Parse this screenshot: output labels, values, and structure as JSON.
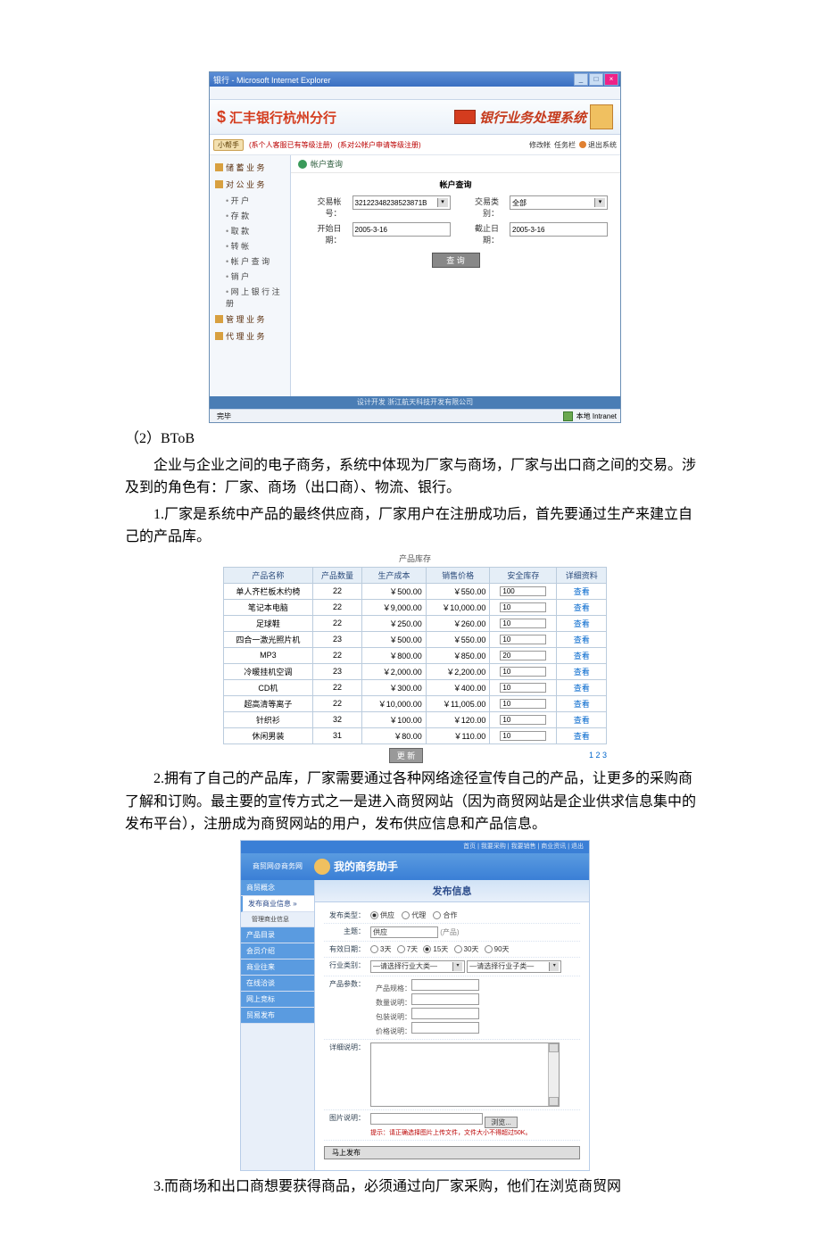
{
  "bank": {
    "window_title": "银行 - Microsoft Internet Explorer",
    "brand_symbol": "$",
    "brand_text": "汇丰银行杭州分行",
    "system_text": "银行业务处理系统",
    "notice_handbook": "小帮手",
    "notice1": "(系个人客服已有等级注册)",
    "notice2": "(系对公帐户申请等级注册)",
    "nr_change": "修改帐",
    "nr_task": "任务栏",
    "nr_exit": "退出系统",
    "sub_title": "帐户查询",
    "form_title": "帐户查询",
    "form": {
      "acct_label": "交易帐号：",
      "acct_value": "32122348238523871B",
      "type_label": "交易类别：",
      "type_value": "全部",
      "start_label": "开始日期：",
      "start_value": "2005-3-16",
      "end_label": "截止日期：",
      "end_value": "2005-3-16",
      "search_btn": "查 询"
    },
    "sidebar": {
      "deposit": "储 蓄 业 务",
      "personal": "对 公 业 务",
      "items": [
        "开 户",
        "存 款",
        "取 款",
        "转 帐",
        "帐 户 查 询",
        "销 户",
        "网 上 银 行 注 册"
      ],
      "mgmt": "管 理 业 务",
      "fin": "代 理 业 务"
    },
    "footer": "设计开发 浙江航天科技开发有限公司",
    "status_done": "完毕",
    "status_net": "本地 Intranet"
  },
  "text": {
    "line1_label": "（2）BToB",
    "para1": "企业与企业之间的电子商务，系统中体现为厂家与商场，厂家与出口商之间的交易。涉及到的角色有：厂家、商场（出口商）、物流、银行。",
    "para2": "1.厂家是系统中产品的最终供应商，厂家用户在注册成功后，首先要通过生产来建立自己的产品库。",
    "para3": "2.拥有了自己的产品库，厂家需要通过各种网络途径宣传自己的产品，让更多的采购商了解和订购。最主要的宣传方式之一是进入商贸网站（因为商贸网站是企业供求信息集中的发布平台），注册成为商贸网站的用户，发布供应信息和产品信息。",
    "para4": "3.而商场和出口商想要获得商品，必须通过向厂家采购，他们在浏览商贸网"
  },
  "inv": {
    "title": "产品库存",
    "headers": [
      "产品名称",
      "产品数量",
      "生产成本",
      "销售价格",
      "安全库存",
      "详细资料"
    ],
    "look": "查看",
    "update_btn": "更 新",
    "pager": "1 2 3",
    "rows": [
      {
        "name": "单人齐栏板木约椅",
        "qty": 22,
        "cost": "￥500.00",
        "price": "￥550.00",
        "safe": "100"
      },
      {
        "name": "笔记本电脑",
        "qty": 22,
        "cost": "￥9,000.00",
        "price": "￥10,000.00",
        "safe": "10"
      },
      {
        "name": "足球鞋",
        "qty": 22,
        "cost": "￥250.00",
        "price": "￥260.00",
        "safe": "10"
      },
      {
        "name": "四合一激光照片机",
        "qty": 23,
        "cost": "￥500.00",
        "price": "￥550.00",
        "safe": "10"
      },
      {
        "name": "MP3",
        "qty": 22,
        "cost": "￥800.00",
        "price": "￥850.00",
        "safe": "20"
      },
      {
        "name": "冷暖挂机空调",
        "qty": 23,
        "cost": "￥2,000.00",
        "price": "￥2,200.00",
        "safe": "10"
      },
      {
        "name": "CD机",
        "qty": 22,
        "cost": "￥300.00",
        "price": "￥400.00",
        "safe": "10"
      },
      {
        "name": "超高清等离子",
        "qty": 22,
        "cost": "￥10,000.00",
        "price": "￥11,005.00",
        "safe": "10"
      },
      {
        "name": "针织衫",
        "qty": 32,
        "cost": "￥100.00",
        "price": "￥120.00",
        "safe": "10"
      },
      {
        "name": "休闲男装",
        "qty": 31,
        "cost": "￥80.00",
        "price": "￥110.00",
        "safe": "10"
      }
    ]
  },
  "pub": {
    "topbar": "首页 | 我要采购 | 我要销售 | 商业资讯 | 退出",
    "logo": "商贸网@商务网",
    "title": "我的商务助手",
    "side": {
      "head": "商贸概念",
      "active": "发布商业信息 »",
      "sub": "管理商业信息",
      "items": [
        "产品目录",
        "会员介绍",
        "商业往来",
        "在线洽谈",
        "网上竞标",
        "贸易发布"
      ]
    },
    "main_title": "发布信息",
    "form": {
      "type_label": "发布类型：",
      "type_opts": [
        "供应",
        "代理",
        "合作"
      ],
      "subject_label": "主题：",
      "subject_value": "供应",
      "subject_suffix": "(产品)",
      "expire_label": "有效日期：",
      "expire_opts": [
        "3天",
        "7天",
        "15天",
        "30天",
        "90天"
      ],
      "industry_label": "行业类别：",
      "industry_sel1": "—请选择行业大类—",
      "industry_sel2": "—请选择行业子类—",
      "param_label": "产品参数：",
      "param_fields": [
        "产品规格：",
        "数量说明：",
        "包装说明：",
        "价格说明："
      ],
      "detail_label": "详细说明：",
      "image_label": "图片说明：",
      "browse_btn": "浏览...",
      "image_note": "提示：请正确选择图片上传文件，文件大小不得超过50K。",
      "submit_btn": "马上发布"
    }
  }
}
